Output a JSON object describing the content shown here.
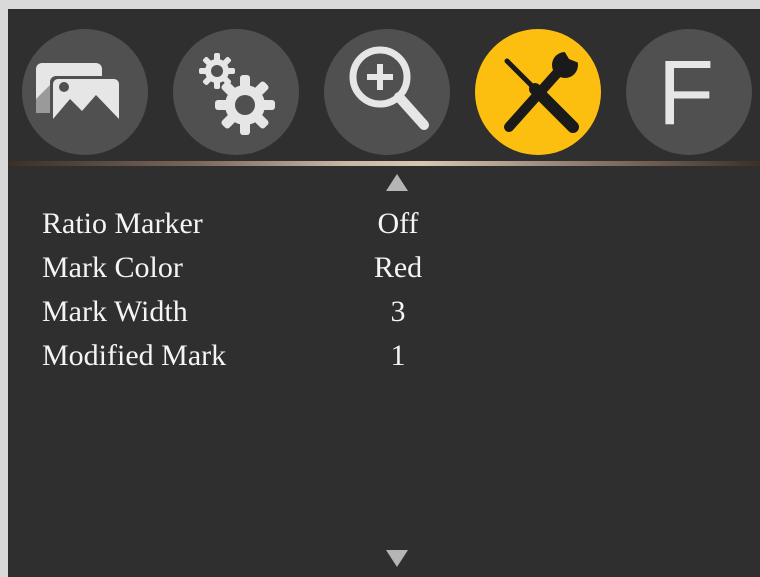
{
  "tabs": [
    {
      "name": "picture",
      "icon": "picture-icon",
      "active": false
    },
    {
      "name": "settings",
      "icon": "gears-icon",
      "active": false
    },
    {
      "name": "zoom",
      "icon": "zoom-in-icon",
      "active": false
    },
    {
      "name": "tools",
      "icon": "tools-icon",
      "active": true
    },
    {
      "name": "function",
      "icon": "function-f-icon",
      "label": "F",
      "active": false
    }
  ],
  "colors": {
    "background": "#2f2f2f",
    "tab_inactive": "#505050",
    "tab_active": "#fcbf10",
    "icon": "#e6e6e6",
    "text": "#f4f4f4"
  },
  "menu": {
    "items": [
      {
        "label": "Ratio Marker",
        "value": "Off"
      },
      {
        "label": "Mark Color",
        "value": "Red"
      },
      {
        "label": "Mark Width",
        "value": "3"
      },
      {
        "label": "Modified Mark",
        "value": "1"
      }
    ]
  },
  "scroll": {
    "up_icon": "arrow-up-icon",
    "down_icon": "arrow-down-icon"
  }
}
